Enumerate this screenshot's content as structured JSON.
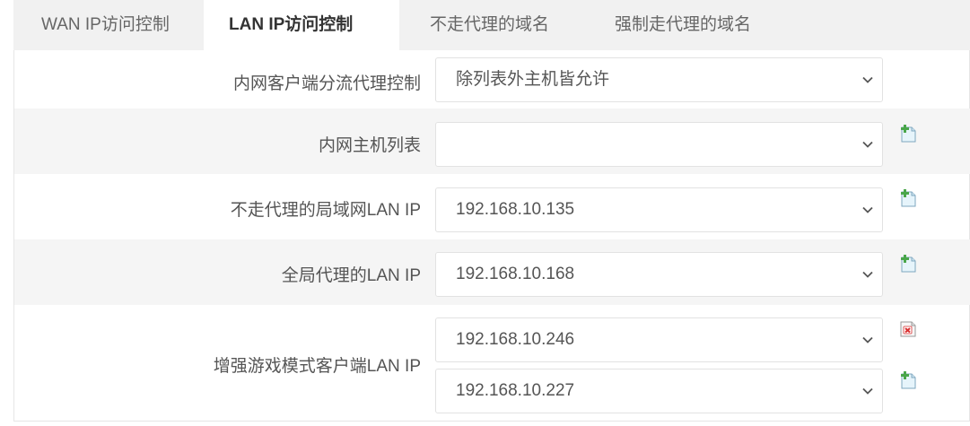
{
  "tabs": [
    {
      "label": "WAN IP访问控制"
    },
    {
      "label": "LAN IP访问控制"
    },
    {
      "label": "不走代理的域名"
    },
    {
      "label": "强制走代理的域名"
    }
  ],
  "active_tab": "LAN IP访问控制",
  "form": {
    "lan_proxy_mode": {
      "label": "内网客户端分流代理控制",
      "value": "除列表外主机皆允许"
    },
    "lan_host_list": {
      "label": "内网主机列表",
      "value": ""
    },
    "bypass_lan_ip": {
      "label": "不走代理的局域网LAN IP",
      "value": "192.168.10.135"
    },
    "global_proxy_lan_ip": {
      "label": "全局代理的LAN IP",
      "value": "192.168.10.168"
    },
    "game_mode_lan_ip": {
      "label": "增强游戏模式客户端LAN IP",
      "values": [
        "192.168.10.246",
        "192.168.10.227"
      ]
    }
  },
  "icons": {
    "add": "add-row-icon",
    "remove": "remove-row-icon",
    "chevron": "chevron-down-icon"
  },
  "colors": {
    "tab_bar": "#f1f1f1",
    "row_shade": "#f5f5f5",
    "add_icon": "#4aa64a",
    "remove_icon": "#d93030"
  }
}
